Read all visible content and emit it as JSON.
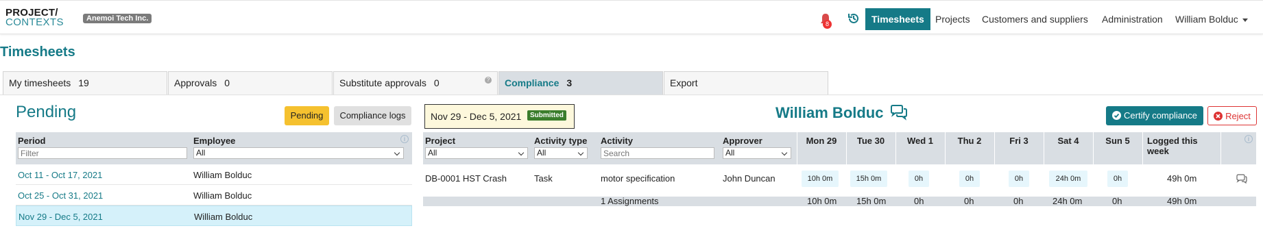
{
  "app": {
    "logo_line1": "PROJECT/",
    "logo_line2": "CONTEXTS",
    "company": "Anemoi Tech Inc.",
    "notification_count": "8"
  },
  "nav": {
    "active": "Timesheets",
    "items": [
      "Projects",
      "Customers and suppliers",
      "Administration"
    ],
    "user": "William Bolduc"
  },
  "page": {
    "title": "Timesheets"
  },
  "tabs": [
    {
      "label": "My timesheets",
      "count": "19"
    },
    {
      "label": "Approvals",
      "count": "0"
    },
    {
      "label": "Substitute approvals",
      "count": "0"
    },
    {
      "label": "Compliance",
      "count": "3"
    },
    {
      "label": "Export",
      "count": ""
    }
  ],
  "left": {
    "title": "Pending",
    "pending_button": "Pending",
    "logs_button": "Compliance logs",
    "columns": {
      "period": "Period",
      "employee": "Employee"
    },
    "filter_placeholder": "Filter",
    "employee_filter": "All",
    "rows": [
      {
        "period": "Oct 11 - Oct 17, 2021",
        "employee": "William Bolduc"
      },
      {
        "period": "Oct 25 - Oct 31, 2021",
        "employee": "William Bolduc"
      },
      {
        "period": "Nov 29 - Dec 5, 2021",
        "employee": "William Bolduc"
      }
    ]
  },
  "right": {
    "period": "Nov 29 - Dec 5, 2021",
    "status": "Submitted",
    "employee": "William Bolduc",
    "certify_button": "Certify compliance",
    "reject_button": "Reject",
    "columns": {
      "project": "Project",
      "activity_type": "Activity type",
      "activity": "Activity",
      "approver": "Approver",
      "logged_line1": "Logged this",
      "logged_line2": "week"
    },
    "filters": {
      "project": "All",
      "activity_type": "All",
      "activity_placeholder": "Search",
      "approver": "All"
    },
    "days": [
      "Mon 29",
      "Tue 30",
      "Wed 1",
      "Thu 2",
      "Fri 3",
      "Sat 4",
      "Sun 5"
    ],
    "row": {
      "project": "DB-0001 HST Crash",
      "activity_type": "Task",
      "activity": "motor specification",
      "approver": "John Duncan",
      "hours": [
        "10h 0m",
        "15h 0m",
        "0h",
        "0h",
        "0h",
        "24h 0m",
        "0h"
      ],
      "logged": "49h 0m"
    },
    "totals": {
      "assignments": "1 Assignments",
      "hours": [
        "10h 0m",
        "15h 0m",
        "0h",
        "0h",
        "0h",
        "24h 0m",
        "0h"
      ],
      "logged": "49h 0m"
    }
  }
}
